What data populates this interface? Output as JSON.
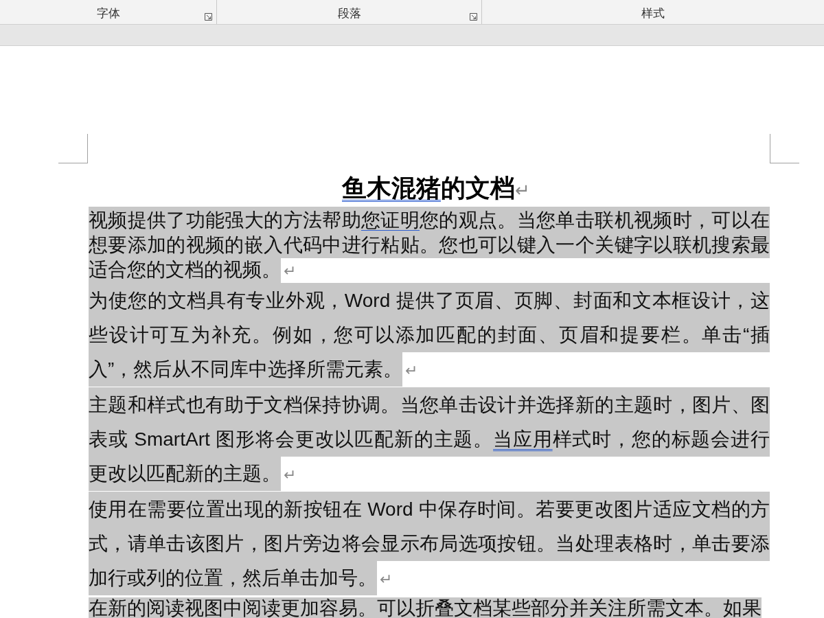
{
  "ribbon_groups": [
    {
      "label": "字体",
      "launcher": true
    },
    {
      "label": "段落",
      "launcher": true
    },
    {
      "label": "样式",
      "launcher": false
    }
  ],
  "document": {
    "title": {
      "segments": [
        {
          "text": "鱼木混猪",
          "proofing": true
        },
        {
          "text": "的文档",
          "proofing": false
        }
      ],
      "mark": "↵"
    },
    "paragraphs": [
      {
        "kind": "compact",
        "highlighted": true,
        "mark": "↵",
        "segments": [
          {
            "text": "视频提供了功能强大的方法帮助",
            "proofing": false
          },
          {
            "text": "您证明",
            "proofing": true
          },
          {
            "text": "您的观点。当您单击联机视频时，可以在想要添加的视频的嵌入代码中进行粘贴。您也可以键入一个关键字以联机搜索最适合您的文档的视频。",
            "proofing": false
          }
        ]
      },
      {
        "kind": "wide",
        "highlighted": true,
        "mark": "↵",
        "segments": [
          {
            "text": "为使您的文档具有专业外观，Word 提供了页眉、页脚、封面和文本框设计，这些设计可互为补充。例如，您可以添加匹配的封面、页眉和提要栏。单击“插入”，然后从不同库中选择所需元素。",
            "proofing": false
          }
        ]
      },
      {
        "kind": "wide",
        "highlighted": true,
        "mark": "↵",
        "segments": [
          {
            "text": "主题和样式也有助于文档保持协调。当您单击设计并选择新的主题时，图片、图表或 SmartArt 图形将会更改以匹配新的主题。",
            "proofing": false
          },
          {
            "text": "当应用",
            "proofing": true
          },
          {
            "text": "样式时，您的标题会进行更改以匹配新的主题。",
            "proofing": false
          }
        ]
      },
      {
        "kind": "wide",
        "highlighted": true,
        "mark": "↵",
        "segments": [
          {
            "text": "使用在需要位置出现的新按钮在 Word 中保存时间。若要更改图片适应文档的方式，请单击该图片，图片旁边将会显示布局选项按钮。当处理表格时，单击要添加行或列的位置，然后单击加号。",
            "proofing": false
          }
        ]
      },
      {
        "kind": "tight",
        "highlighted": true,
        "segments": [
          {
            "text": "在新的阅读视图中阅读更加容易。可以折叠文档某些部分并关注所需文本。如果"
          }
        ]
      }
    ]
  }
}
